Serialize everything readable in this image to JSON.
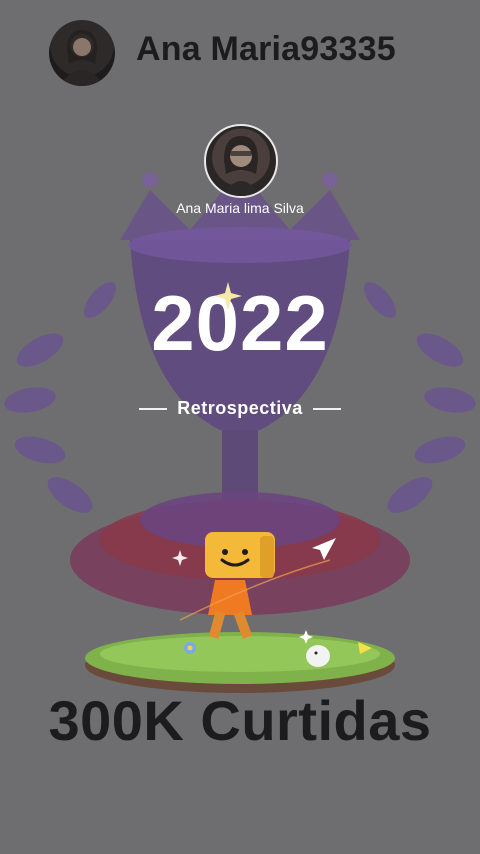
{
  "header": {
    "username": "Ana Maria93335"
  },
  "profile": {
    "full_name": "Ana Maria lima Silva"
  },
  "recap": {
    "year": "2022",
    "subtitle": "Retrospectiva"
  },
  "stat": {
    "likes_label": "300K Curtidas"
  },
  "colors": {
    "background": "#6e6e70",
    "trophy": "#6a4f8e",
    "accent": "#f5b93a"
  }
}
